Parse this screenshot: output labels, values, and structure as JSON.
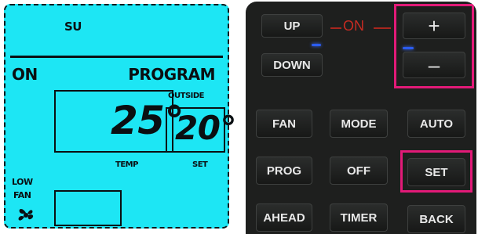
{
  "lcd": {
    "day": "SU",
    "mode": "ON",
    "program": "PROGRAM",
    "outside_label": "OUTSIDE",
    "temp_value": "25°",
    "set_value": "20°",
    "temp_label": "TEMP",
    "set_label": "SET",
    "fan_speed": "LOW",
    "fan_label": "FAN"
  },
  "remote": {
    "up": "UP",
    "down": "DOWN",
    "on": "ON",
    "plus": "+",
    "minus": "–",
    "fan": "FAN",
    "mode": "MODE",
    "auto": "AUTO",
    "prog": "PROG",
    "off": "OFF",
    "set": "SET",
    "ahead": "AHEAD",
    "timer": "TIMER",
    "back": "BACK"
  },
  "colors": {
    "lcd_background": "#1de6f4",
    "highlight": "#e21a78",
    "on_label": "#c62b22",
    "led": "#2b5cf0"
  }
}
